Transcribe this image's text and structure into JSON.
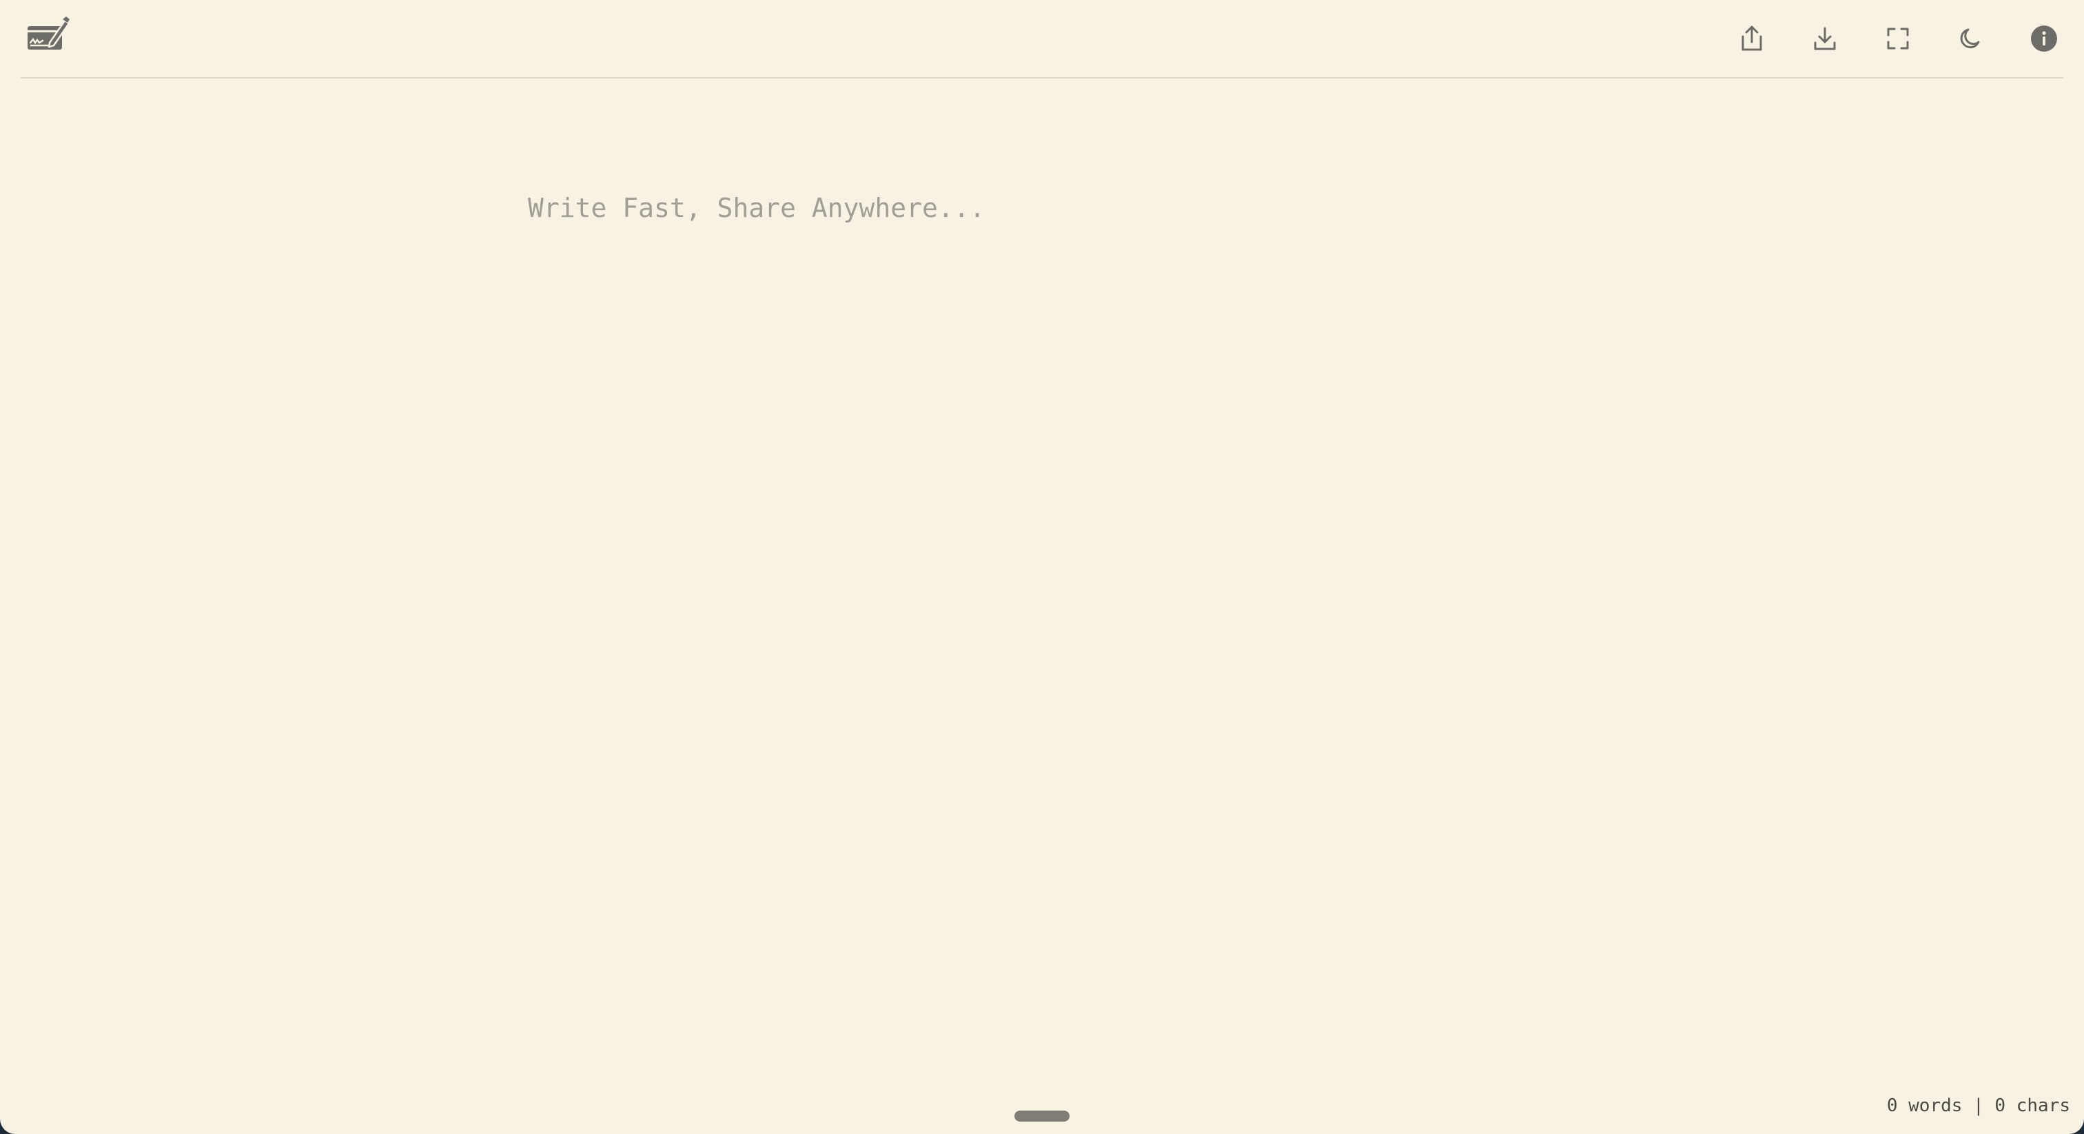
{
  "colors": {
    "background": "#f7f2e3",
    "icon": "#6e6c66",
    "placeholder": "#a19e94",
    "divider": "#ddd8ca",
    "handle": "#807d74"
  },
  "header": {
    "logo_icon": "note-signature-icon",
    "toolbar": [
      {
        "name": "share-button",
        "icon": "share-icon"
      },
      {
        "name": "download-button",
        "icon": "download-icon"
      },
      {
        "name": "fullscreen-button",
        "icon": "fullscreen-icon"
      },
      {
        "name": "dark-mode-button",
        "icon": "moon-icon"
      },
      {
        "name": "info-button",
        "icon": "info-icon"
      }
    ]
  },
  "editor": {
    "value": "",
    "placeholder": "Write Fast, Share Anywhere..."
  },
  "status": {
    "words": "0",
    "words_label": "words",
    "separator": "|",
    "chars": "0",
    "chars_label": "chars"
  }
}
